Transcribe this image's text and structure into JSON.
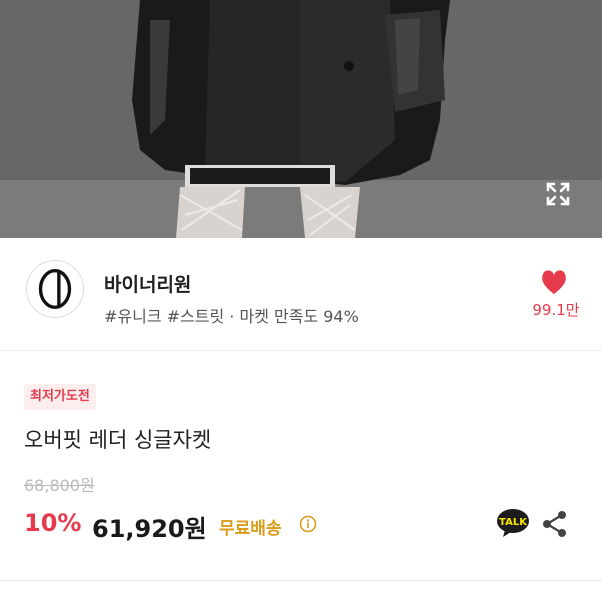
{
  "seller": {
    "name": "바이너리원",
    "meta": "#유니크 #스트릿 · 마켓 만족도 94%",
    "likes": "99.1만"
  },
  "product": {
    "badge": "최저가도전",
    "title": "오버핏 레더 싱글자켓",
    "original_price": "68,800원",
    "discount": "10%",
    "price": "61,920원",
    "shipping": "무료배송"
  },
  "talk_label": "TALK",
  "colors": {
    "accent_red": "#e53b4d",
    "shipping_gold": "#d99b18",
    "badge_bg": "#fdeeee"
  },
  "icons": {
    "expand": "expand-icon",
    "heart": "heart-icon",
    "info": "info-icon",
    "talk": "kakaotalk-icon",
    "share": "share-icon"
  }
}
